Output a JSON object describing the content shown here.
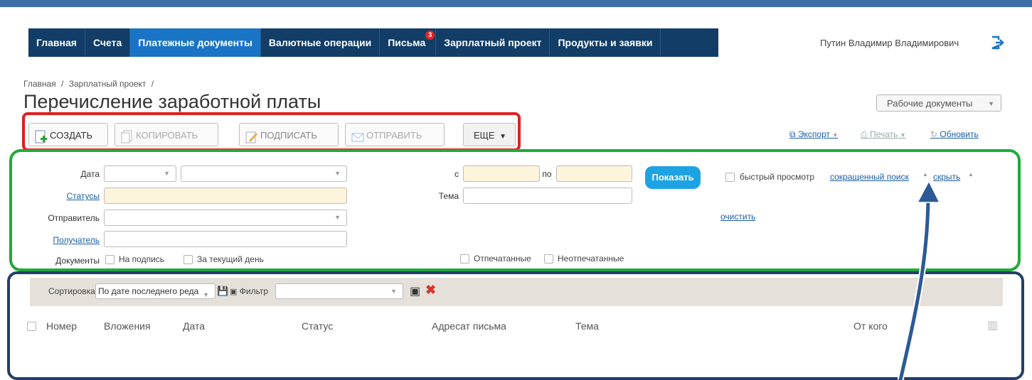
{
  "nav": {
    "items": [
      {
        "label": "Главная"
      },
      {
        "label": "Счета"
      },
      {
        "label": "Платежные документы"
      },
      {
        "label": "Валютные операции"
      },
      {
        "label": "Письма",
        "badge": "3"
      },
      {
        "label": "Зарплатный проект"
      },
      {
        "label": "Продукты и заявки"
      }
    ],
    "active": "Платежные документы"
  },
  "user": {
    "name": "Путин Владимир Владимирович"
  },
  "breadcrumb": [
    "Главная",
    "/",
    "Зарплатный проект",
    "/"
  ],
  "page": {
    "title": "Перечисление заработной платы"
  },
  "workdocs": {
    "label": "Рабочие документы"
  },
  "toolbar": {
    "create": "СОЗДАТЬ",
    "copy": "КОПИРОВАТЬ",
    "sign": "ПОДПИСАТЬ",
    "send": "ОТПРАВИТЬ",
    "more": "ЕЩЕ"
  },
  "actions": {
    "export": "Экспорт",
    "print": "Печать",
    "refresh": "Обновить"
  },
  "filter": {
    "date_label": "Дата",
    "statuses_label": "Статусы",
    "sender_label": "Отправитель",
    "recipient_label": "Получатель",
    "documents_label": "Документы",
    "from_label": "с",
    "to_label": "по",
    "subject_label": "Тема",
    "show_button": "Показать",
    "quick_view": "быстрый просмотр",
    "short_search": "сокращенный поиск",
    "hide": "скрыть",
    "clear": "очистить",
    "to_sign": "На подпись",
    "today": "За текущий день",
    "printed": "Отпечатанные",
    "not_printed": "Неотпечатанные"
  },
  "sortbar": {
    "sort_label": "Сортировка",
    "sort_value": "По дате последнего реда",
    "filter_label": "Фильтр"
  },
  "table": {
    "columns": [
      "Номер",
      "Вложения",
      "Дата",
      "Статус",
      "Адресат письма",
      "Тема",
      "От кого"
    ]
  },
  "colors": {
    "nav_bg": "#123d66",
    "nav_active": "#1a74c5",
    "highlight_red": "#e02020",
    "highlight_green": "#1faa3a",
    "highlight_navy": "#233e6a",
    "show_button": "#1da3e4",
    "input_yellow": "#fdf4dc"
  }
}
